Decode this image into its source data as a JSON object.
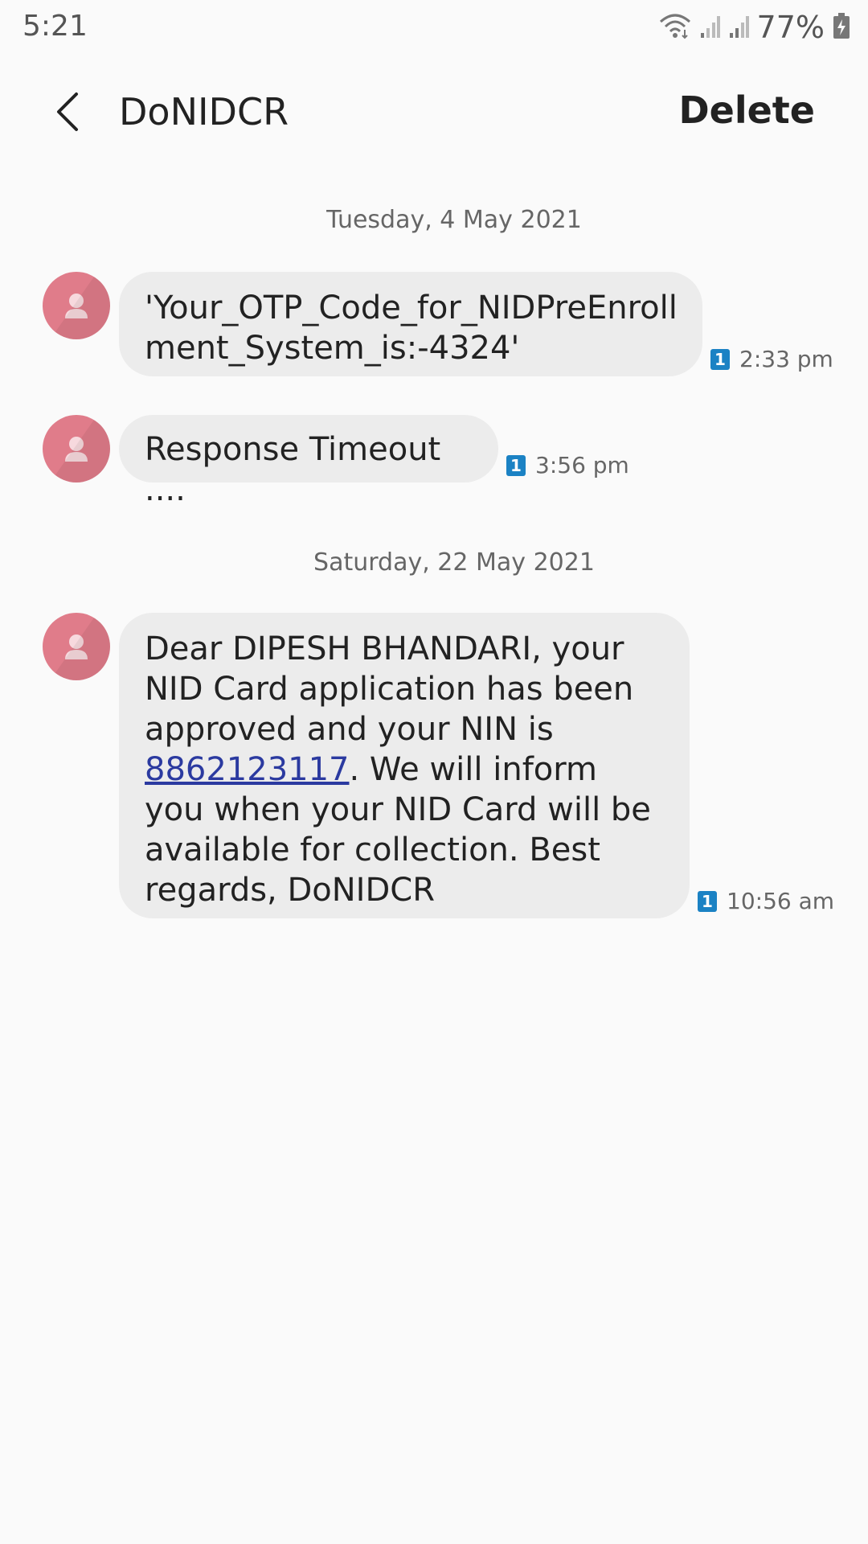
{
  "status_bar": {
    "time": "5:21",
    "battery_text": "77%",
    "icons": [
      "wifi-icon",
      "signal-1-icon",
      "signal-2-icon",
      "battery-charging-icon"
    ]
  },
  "app_bar": {
    "title": "DoNIDCR",
    "delete_label": "Delete",
    "back_icon": "back-arrow-icon"
  },
  "conversation": {
    "groups": [
      {
        "date": "Tuesday, 4 May 2021",
        "messages": [
          {
            "text": "'Your_OTP_Code_for_NIDPreEnroll\nment_System_is:-4324'",
            "sim": "1",
            "time": "2:33 pm"
          },
          {
            "text": "Response Timeout ....",
            "sim": "1",
            "time": "3:56 pm"
          }
        ]
      },
      {
        "date": "Saturday, 22 May 2021",
        "messages": [
          {
            "text_part1": "Dear DIPESH BHANDARI, your\nNID Card application has been\napproved and your NIN is\n",
            "link": "8862123117",
            "text_part2": ". We will inform\nyou when your NID Card will be\navailable for collection. Best\nregards, DoNIDCR",
            "sim": "1",
            "time": "10:56 am"
          }
        ]
      }
    ]
  },
  "colors": {
    "background": "#fafafa",
    "bubble": "#ececec",
    "avatar": "#e07c8a",
    "sim_badge": "#1b82c4",
    "link": "#2b3aa0"
  }
}
